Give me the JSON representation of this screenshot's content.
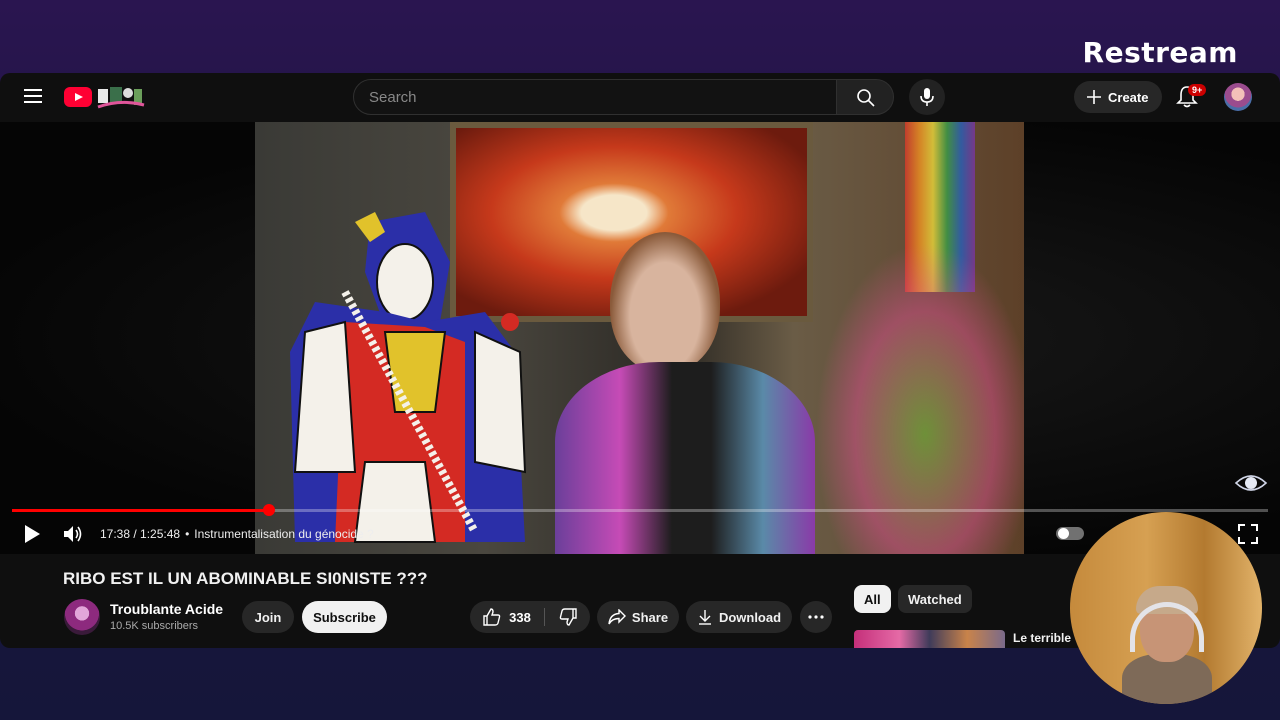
{
  "overlay": {
    "brand": "Restream"
  },
  "header": {
    "search_placeholder": "Search",
    "create_label": "Create",
    "notification_badge": "9+"
  },
  "player": {
    "current_time": "17:38",
    "duration": "1:25:48",
    "time_display": "17:38 / 1:25:48",
    "chapter": "Instrumentalisation du génocide ?",
    "progress_fraction": 0.205,
    "colors": {
      "progress": "#ff0000",
      "accent": "#ff0033"
    }
  },
  "video": {
    "title": "RIBO EST IL UN ABOMINABLE SI0NISTE ???",
    "channel_name": "Troublante Acide",
    "subscribers": "10.5K subscribers",
    "join_label": "Join",
    "subscribe_label": "Subscribe",
    "likes": "338",
    "share_label": "Share",
    "download_label": "Download"
  },
  "sidebar": {
    "chips": [
      "All",
      "Watched"
    ],
    "recommendation_title": "Le terrible"
  }
}
